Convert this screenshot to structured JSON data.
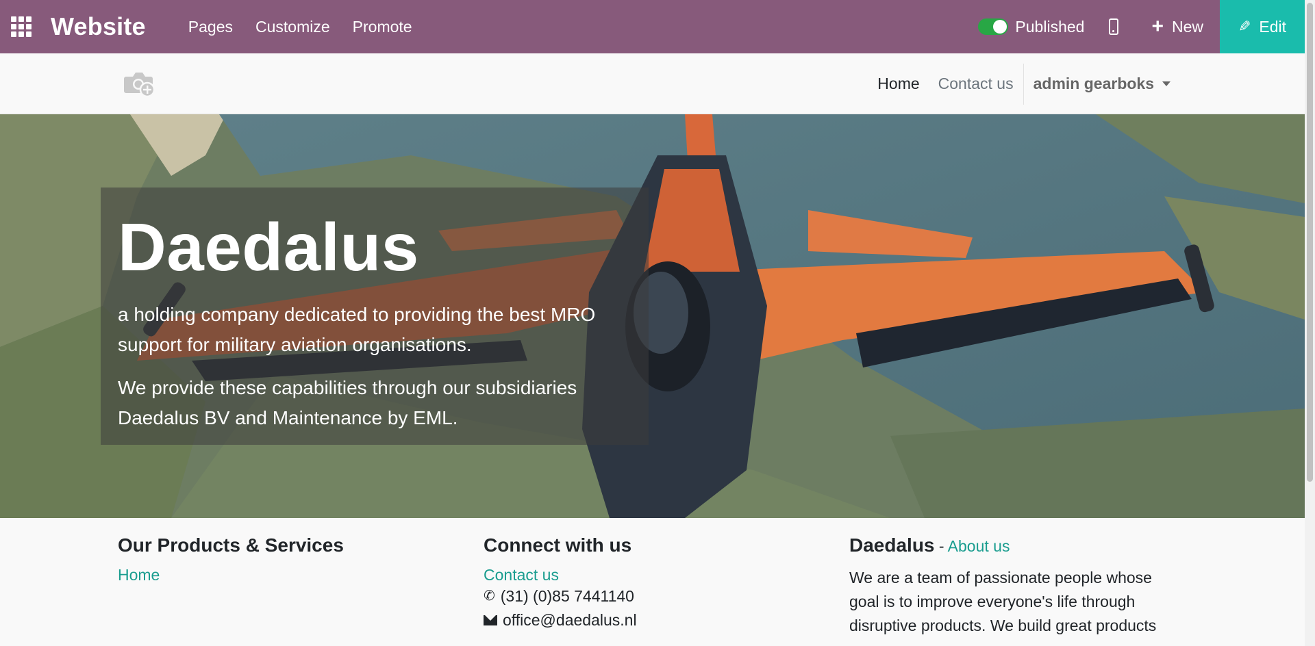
{
  "admin_bar": {
    "brand": "Website",
    "menu": [
      "Pages",
      "Customize",
      "Promote"
    ],
    "published_label": "Published",
    "new_label": "New",
    "edit_label": "Edit",
    "icons": {
      "apps": "apps-grid-icon",
      "mobile": "mobile-preview-icon",
      "plus": "plus-icon",
      "pencil": "pencil-icon"
    }
  },
  "site_header": {
    "logo_icon": "camera-plus-icon",
    "nav": [
      "Home",
      "Contact us"
    ],
    "user": "admin gearboks"
  },
  "hero": {
    "title": "Daedalus",
    "paragraph1": " a holding company dedicated to providing the best MRO support for military aviation organisations.",
    "paragraph2": " We provide these capabilities through our subsidiaries Daedalus BV and Maintenance by EML."
  },
  "footer": {
    "products": {
      "heading": "Our Products & Services",
      "links": [
        "Home"
      ]
    },
    "connect": {
      "heading": "Connect with us",
      "contact_link": "Contact us",
      "phone": "(31) (0)85 7441140",
      "email": "office@daedalus.nl"
    },
    "about": {
      "heading": "Daedalus",
      "separator": " - ",
      "about_link": "About us",
      "text": "We are a team of passionate people whose goal is to improve everyone's life through disruptive products. We build great products"
    }
  },
  "colors": {
    "admin_bar": "#875a7b",
    "edit_button": "#1abcac",
    "toggle_on": "#28a745",
    "link": "#1a9d8f"
  }
}
